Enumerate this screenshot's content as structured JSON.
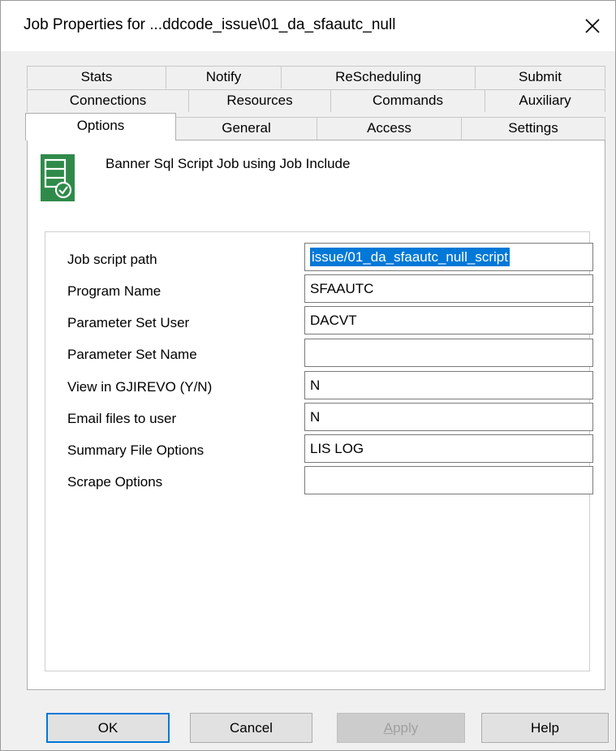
{
  "window": {
    "title": "Job Properties for ...ddcode_issue\\01_da_sfaautc_null"
  },
  "tabs": {
    "row1": [
      "Stats",
      "Notify",
      "ReScheduling",
      "Submit"
    ],
    "row2": [
      "Connections",
      "Resources",
      "Commands",
      "Auxiliary"
    ],
    "row3": [
      "Options",
      "General",
      "Access",
      "Settings"
    ],
    "active": "Options"
  },
  "options": {
    "icon": "sql-script-job-icon",
    "description": "Banner Sql Script Job using Job Include",
    "fields": [
      {
        "label": "Job script path",
        "value": "issue/01_da_sfaautc_null_script"
      },
      {
        "label": "Program Name",
        "value": "SFAAUTC"
      },
      {
        "label": "Parameter Set User",
        "value": "DACVT"
      },
      {
        "label": "Parameter Set Name",
        "value": ""
      },
      {
        "label": "View in GJIREVO (Y/N)",
        "value": "N"
      },
      {
        "label": "Email files to user",
        "value": "N"
      },
      {
        "label": "Summary File Options",
        "value": "LIS LOG"
      },
      {
        "label": "Scrape Options",
        "value": ""
      }
    ]
  },
  "buttons": {
    "ok": "OK",
    "cancel": "Cancel",
    "apply_first": "A",
    "apply_rest": "pply",
    "help": "Help"
  },
  "colors": {
    "accent": "#0078d7",
    "icon_green": "#2f8a4a"
  }
}
